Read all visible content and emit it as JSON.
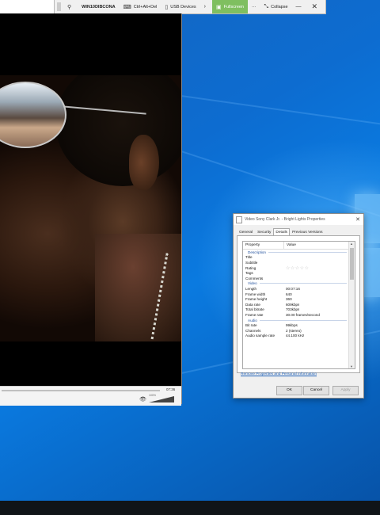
{
  "connection_bar": {
    "machine": "WIN10DIBCONA",
    "ctrl_alt_del": "Ctrl+Alt+Del",
    "usb": "USB Devices",
    "fullscreen": "Fullscreen",
    "more": "···",
    "collapse": "Collapse"
  },
  "player": {
    "time": "07:36",
    "volume_pct": "100%",
    "volume_level": 1.0
  },
  "dialog": {
    "title": "Video Sony Clark Jr. - Bright Lights Properties",
    "tabs": [
      "General",
      "Security",
      "Details",
      "Previous Versions"
    ],
    "selected_tab": "Details",
    "columns": {
      "property": "Property",
      "value": "Value"
    },
    "sections": {
      "description": "Description",
      "video": "Video",
      "audio": "Audio"
    },
    "description_rows": [
      {
        "k": "Title",
        "v": ""
      },
      {
        "k": "Subtitle",
        "v": ""
      },
      {
        "k": "Rating",
        "v": "☆☆☆☆☆"
      },
      {
        "k": "Tags",
        "v": ""
      },
      {
        "k": "Comments",
        "v": ""
      }
    ],
    "video_rows": [
      {
        "k": "Length",
        "v": "00:07:16"
      },
      {
        "k": "Frame width",
        "v": "640"
      },
      {
        "k": "Frame height",
        "v": "360"
      },
      {
        "k": "Data rate",
        "v": "609kbps"
      },
      {
        "k": "Total bitrate",
        "v": "703kbps"
      },
      {
        "k": "Frame rate",
        "v": "30.00 frames/second"
      }
    ],
    "audio_rows": [
      {
        "k": "Bit rate",
        "v": "99kbps"
      },
      {
        "k": "Channels",
        "v": "2 (stereo)"
      },
      {
        "k": "Audio sample rate",
        "v": "44.100 kHz"
      }
    ],
    "link": "Remove Properties and Personal Information",
    "buttons": {
      "ok": "OK",
      "cancel": "Cancel",
      "apply": "Apply"
    }
  }
}
